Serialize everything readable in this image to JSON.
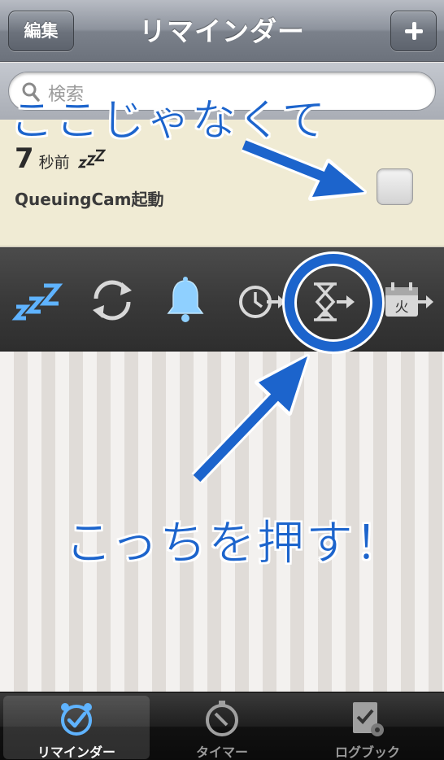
{
  "navbar": {
    "title": "リマインダー",
    "edit_label": "編集",
    "add_icon": "plus-icon"
  },
  "search": {
    "placeholder": "検索",
    "icon": "search-icon"
  },
  "reminder": {
    "time_value": "7",
    "time_unit": "秒前",
    "snooze_icon": "zzz-icon",
    "title": "QueuingCam起動"
  },
  "actions": [
    {
      "name": "snooze",
      "icon": "zzz-icon"
    },
    {
      "name": "repeat",
      "icon": "repeat-icon"
    },
    {
      "name": "alarm",
      "icon": "bell-icon"
    },
    {
      "name": "postpone",
      "icon": "clock-arrow-icon"
    },
    {
      "name": "timer",
      "icon": "hourglass-arrow-icon"
    },
    {
      "name": "weekday",
      "icon": "calendar-arrow-icon",
      "label": "火"
    }
  ],
  "tabs": [
    {
      "label": "リマインダー",
      "icon": "alarm-clock-icon",
      "active": true
    },
    {
      "label": "タイマー",
      "icon": "stopwatch-icon",
      "active": false
    },
    {
      "label": "ログブック",
      "icon": "logbook-icon",
      "active": false
    }
  ],
  "annotations": {
    "top_text": "ここじゃなくて",
    "bottom_text": "こっちを押す！",
    "color": "#1c64cc"
  },
  "colors": {
    "reminder_bg": "#f0ebd4",
    "toolbar_bg": "#3a3a3a",
    "accent_blue": "#5fb3ff"
  }
}
